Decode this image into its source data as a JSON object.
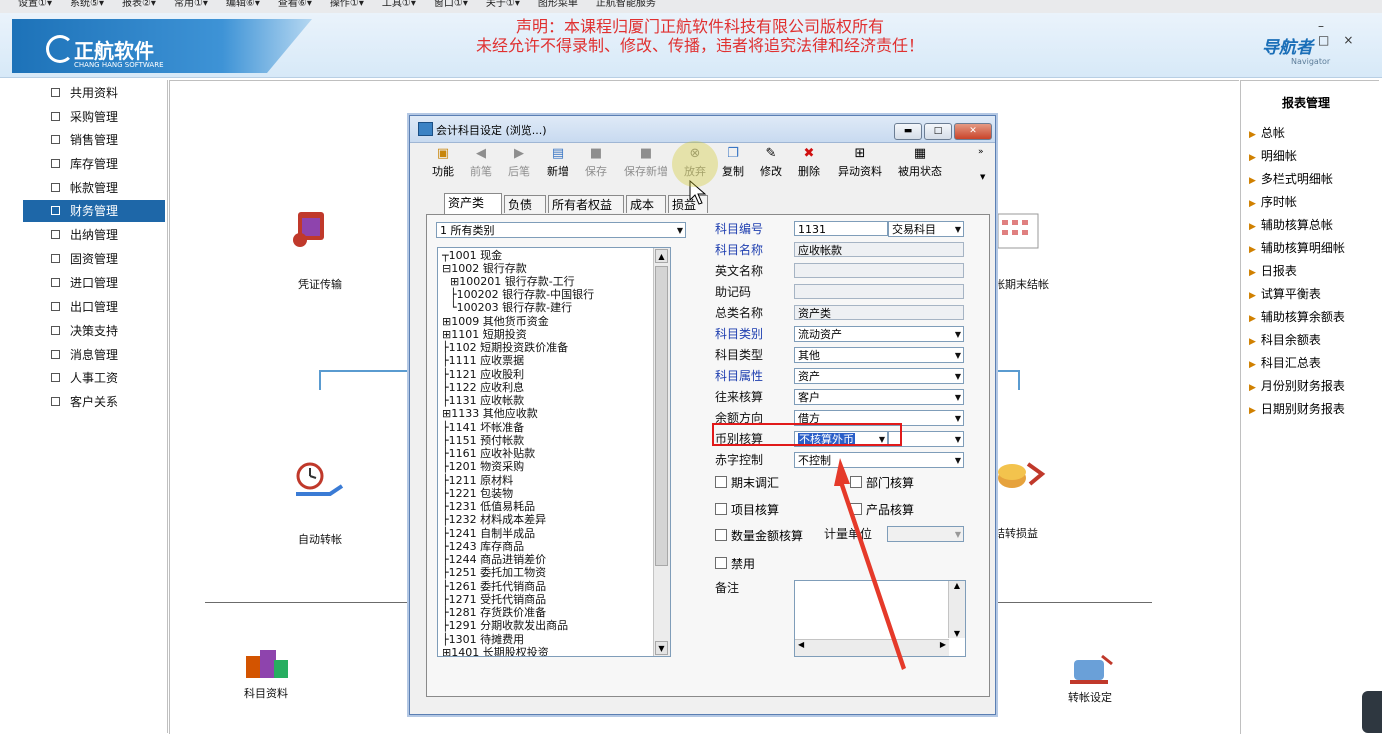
{
  "menubar": [
    "设置①▾",
    "系统⑤▾",
    "报表②▾",
    "常用①▾",
    "编辑⑥▾",
    "查看⑥▾",
    "操作①▾",
    "工具①▾",
    "窗口①▾",
    "关于①▾",
    "图形菜单",
    "正航智能服务"
  ],
  "header": {
    "logo_text": "正航软件",
    "logo_sub": "CHANG HANG SOFTWARE",
    "notice_line1": "声明：本课程归厦门正航软件科技有限公司版权所有",
    "notice_line2": "未经允许不得录制、修改、传播，违者将追究法律和经济责任！",
    "navigator_text": "导航者",
    "navigator_sub": "Navigator",
    "window_buttons": "–□×"
  },
  "sidebar": {
    "items": [
      {
        "label": "共用资料",
        "icon": "document-icon"
      },
      {
        "label": "采购管理",
        "icon": "cart-icon"
      },
      {
        "label": "销售管理",
        "icon": "sales-icon"
      },
      {
        "label": "库存管理",
        "icon": "warehouse-icon"
      },
      {
        "label": "帐款管理",
        "icon": "account-icon"
      },
      {
        "label": "财务管理",
        "icon": "finance-icon",
        "active": true
      },
      {
        "label": "出纳管理",
        "icon": "cashier-icon"
      },
      {
        "label": "固资管理",
        "icon": "asset-icon"
      },
      {
        "label": "进口管理",
        "icon": "import-icon"
      },
      {
        "label": "出口管理",
        "icon": "export-icon"
      },
      {
        "label": "决策支持",
        "icon": "decision-icon"
      },
      {
        "label": "消息管理",
        "icon": "chart-icon"
      },
      {
        "label": "人事工资",
        "icon": "hr-icon"
      },
      {
        "label": "客户关系",
        "icon": "customer-icon"
      }
    ]
  },
  "flow": {
    "voucher": "凭证传输",
    "auto_transfer": "自动转帐",
    "subject_data": "科目资料",
    "period_close": "帐期末结帐",
    "close_pl": "结转损益",
    "transfer_setting": "转帐设定"
  },
  "right_panel": {
    "title": "报表管理",
    "items": [
      "总帐",
      "明细帐",
      "多栏式明细帐",
      "序时帐",
      "辅助核算总帐",
      "辅助核算明细帐",
      "日报表",
      "试算平衡表",
      "辅助核算余额表",
      "科目余额表",
      "科目汇总表",
      "月份别财务报表",
      "日期别财务报表"
    ]
  },
  "dialog": {
    "title": "会计科目设定 (浏览...)",
    "toolbar": [
      {
        "label": "功能",
        "icon": "box-icon",
        "enabled": true
      },
      {
        "label": "前笔",
        "icon": "arrow-left-icon",
        "enabled": false
      },
      {
        "label": "后笔",
        "icon": "arrow-right-icon",
        "enabled": false
      },
      {
        "label": "新增",
        "icon": "new-icon",
        "enabled": true
      },
      {
        "label": "保存",
        "icon": "save-icon",
        "enabled": false
      },
      {
        "label": "保存新增",
        "icon": "save-new-icon",
        "enabled": false
      },
      {
        "label": "放弃",
        "icon": "cancel-icon",
        "enabled": false
      },
      {
        "label": "复制",
        "icon": "copy-icon",
        "enabled": true
      },
      {
        "label": "修改",
        "icon": "edit-icon",
        "enabled": true
      },
      {
        "label": "删除",
        "icon": "delete-icon",
        "enabled": true
      },
      {
        "label": "异动资料",
        "icon": "change-icon",
        "enabled": true
      },
      {
        "label": "被用状态",
        "icon": "status-icon",
        "enabled": true
      }
    ],
    "tabs": [
      "资产类",
      "负债类",
      "所有者权益类",
      "成本类",
      "损益类"
    ],
    "category_select": "1    所有类别",
    "tree": [
      "┬1001 现金",
      "⊟1002 银行存款",
      "  ⊞100201 银行存款-工行",
      "  ├100202 银行存款-中国银行",
      "  └100203 银行存款-建行",
      "⊞1009 其他货币资金",
      "⊞1101 短期投资",
      "├1102 短期投资跌价准备",
      "├1111 应收票据",
      "├1121 应收股利",
      "├1122 应收利息",
      "├1131 应收帐款",
      "⊞1133 其他应收款",
      "├1141 坏帐准备",
      "├1151 预付帐款",
      "├1161 应收补贴款",
      "├1201 物资采购",
      "├1211 原材料",
      "├1221 包装物",
      "├1231 低值易耗品",
      "├1232 材料成本差异",
      "├1241 自制半成品",
      "├1243 库存商品",
      "├1244 商品进销差价",
      "├1251 委托加工物资",
      "├1261 委托代销商品",
      "├1271 受托代销商品",
      "├1281 存货跌价准备",
      "├1291 分期收款发出商品",
      "├1301 待摊费用",
      "⊞1401 长期股权投资"
    ],
    "form": {
      "code_label": "科目编号",
      "code_value": "1131",
      "code_type": "交易科目",
      "name_label": "科目名称",
      "name_value": "应收帐款",
      "en_name_label": "英文名称",
      "en_name_value": "",
      "mnemonic_label": "助记码",
      "mnemonic_value": "",
      "general_label": "总类名称",
      "general_value": "资产类",
      "category_label": "科目类别",
      "category_value": "流动资产",
      "type_label": "科目类型",
      "type_value": "其他",
      "attr_label": "科目属性",
      "attr_value": "资产",
      "partner_label": "往来核算",
      "partner_value": "客户",
      "balance_label": "余额方向",
      "balance_value": "借方",
      "currency_label": "币别核算",
      "currency_value": "不核算外币",
      "red_label": "赤字控制",
      "red_value": "不控制",
      "cb_period": "期末调汇",
      "cb_dept": "部门核算",
      "cb_project": "项目核算",
      "cb_product": "产品核算",
      "cb_qty": "数量金额核算",
      "unit_label": "计量单位",
      "cb_disable": "禁用",
      "memo_label": "备注"
    }
  }
}
